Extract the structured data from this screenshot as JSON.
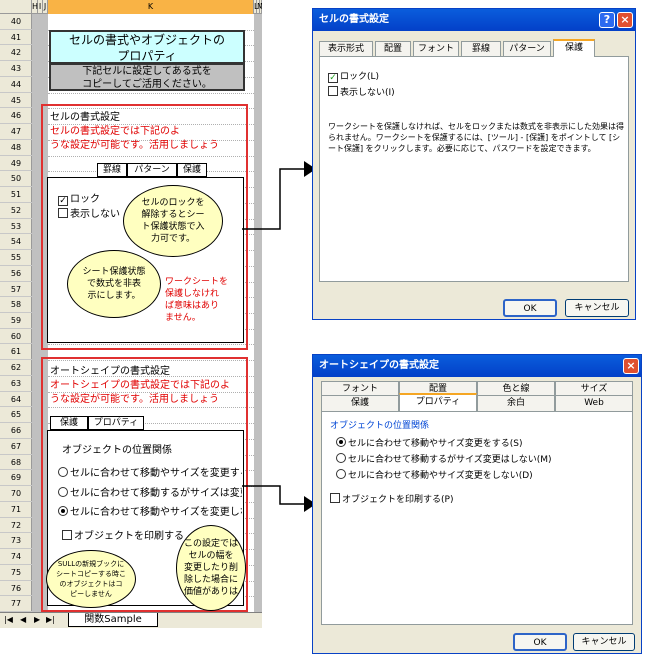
{
  "sheet": {
    "col_headers": [
      "H",
      "I",
      "J",
      "K",
      "L",
      "M",
      "N"
    ],
    "rows": [
      "40",
      "41",
      "42",
      "43",
      "44",
      "45",
      "46",
      "47",
      "48",
      "49",
      "50",
      "51",
      "52",
      "53",
      "54",
      "55",
      "56",
      "57",
      "58",
      "59",
      "60",
      "61",
      "62",
      "63",
      "64",
      "65",
      "66",
      "67",
      "68",
      "69",
      "70",
      "71",
      "72",
      "73",
      "74",
      "75",
      "76",
      "77"
    ],
    "title": "セルの書式やオブジェクトの\nプロパティ",
    "copy_note": "下記セルに設定してある式を\nコピーしてご活用ください。",
    "cell_section": {
      "heading": "セルの書式設定",
      "desc_line1": "セルの書式設定では下記のよ",
      "desc_line2": "うな設定が可能です。活用しましょう",
      "tabs": [
        "罫線",
        "パターン",
        "保護"
      ],
      "lock_label": "ロック",
      "hide_label": "表示しない",
      "bubble1": "セルのロックを\n解除するとシー\nト保護状態で入\n力可です。",
      "bubble2": "シート保護状態\nで数式を非表\n示にします。",
      "warning": "ワークシートを\n保護しなけれ\nば意味はあり\nません。"
    },
    "shape_section": {
      "heading": "オートシェイプの書式設定",
      "desc_line1": "オートシェイプの書式設定では下記のよ",
      "desc_line2": "うな設定が可能です。活用しましょう",
      "tabs": [
        "保護",
        "プロパティ"
      ],
      "group_label": "オブジェクトの位置関係",
      "radio1": "セルに合わせて移動やサイズを変更する",
      "radio2": "セルに合わせて移動するがサイズは変更",
      "radio3": "セルに合わせて移動やサイズを変更しな",
      "print_label": "オブジェクトを印刷する",
      "bubble1": "SULLの新規ブックに\nシートコピーする時こ\nのオブジェクトはコ\nピーしません",
      "bubble2": "この設定では\nセルの幅を\n変更したり削\n除した場合に\n価値がありは"
    },
    "sheet_tab": "関数Sample"
  },
  "dialog1": {
    "title": "セルの書式設定",
    "tabs": [
      "表示形式",
      "配置",
      "フォント",
      "罫線",
      "パターン",
      "保護"
    ],
    "lock": "ロック(L)",
    "hide": "表示しない(I)",
    "description": "ワークシートを保護しなければ、セルをロックまたは数式を非表示にした効果は得られません。ワークシートを保護するには、[ツール] - [保護] をポイントして [シート保護] をクリックします。必要に応じて、パスワードを設定できます。",
    "ok": "OK",
    "cancel": "キャンセル"
  },
  "dialog2": {
    "title": "オートシェイプの書式設定",
    "tabs_row1": [
      "フォント",
      "配置",
      "色と線",
      "サイズ"
    ],
    "tabs_row2": [
      "保護",
      "プロパティ",
      "余白",
      "Web"
    ],
    "group": "オブジェクトの位置関係",
    "radio1": "セルに合わせて移動やサイズ変更をする(S)",
    "radio2": "セルに合わせて移動するがサイズ変更はしない(M)",
    "radio3": "セルに合わせて移動やサイズ変更をしない(D)",
    "print": "オブジェクトを印刷する(P)",
    "ok": "OK",
    "cancel": "キャンセル"
  },
  "colors": {
    "red": "#e00000",
    "bubble": "#ffffc0",
    "title_bg": "#ccffff",
    "titlebar": "#0a5ddc",
    "col_active": "#f9b345"
  }
}
